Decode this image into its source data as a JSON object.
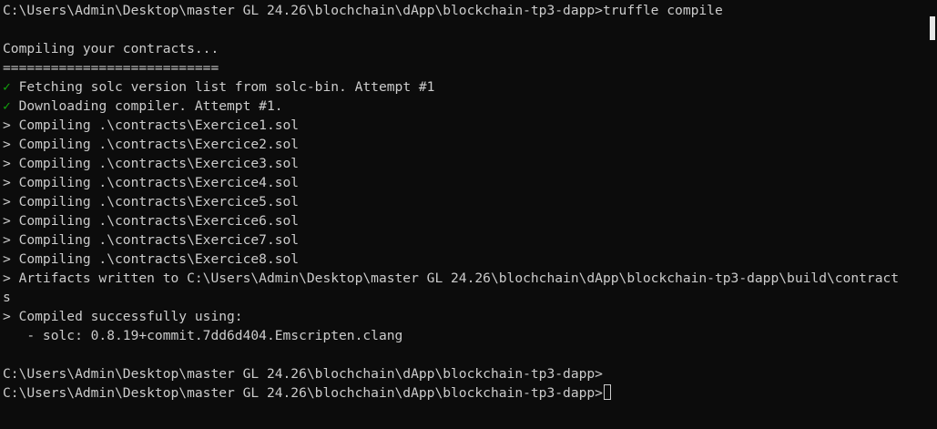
{
  "terminal": {
    "lines": [
      {
        "text": "C:\\Users\\Admin\\Desktop\\master GL 24.26\\blochchain\\dApp\\blockchain-tp3-dapp>truffle compile"
      },
      {
        "text": ""
      },
      {
        "text": "Compiling your contracts..."
      },
      {
        "text": "==========================="
      },
      {
        "mark": "✓",
        "text": " Fetching solc version list from solc-bin. Attempt #1"
      },
      {
        "mark": "✓",
        "text": " Downloading compiler. Attempt #1."
      },
      {
        "text": "> Compiling .\\contracts\\Exercice1.sol"
      },
      {
        "text": "> Compiling .\\contracts\\Exercice2.sol"
      },
      {
        "text": "> Compiling .\\contracts\\Exercice3.sol"
      },
      {
        "text": "> Compiling .\\contracts\\Exercice4.sol"
      },
      {
        "text": "> Compiling .\\contracts\\Exercice5.sol"
      },
      {
        "text": "> Compiling .\\contracts\\Exercice6.sol"
      },
      {
        "text": "> Compiling .\\contracts\\Exercice7.sol"
      },
      {
        "text": "> Compiling .\\contracts\\Exercice8.sol"
      },
      {
        "text": "> Artifacts written to C:\\Users\\Admin\\Desktop\\master GL 24.26\\blochchain\\dApp\\blockchain-tp3-dapp\\build\\contract"
      },
      {
        "text": "s"
      },
      {
        "text": "> Compiled successfully using:"
      },
      {
        "text": "   - solc: 0.8.19+commit.7dd6d404.Emscripten.clang"
      },
      {
        "text": ""
      },
      {
        "text": "C:\\Users\\Admin\\Desktop\\master GL 24.26\\blochchain\\dApp\\blockchain-tp3-dapp>"
      },
      {
        "text": "C:\\Users\\Admin\\Desktop\\master GL 24.26\\blochchain\\dApp\\blockchain-tp3-dapp>"
      }
    ],
    "cursor_line": 20
  },
  "colors": {
    "background": "#0c0c0c",
    "foreground": "#cccccc",
    "checkmark": "#13a10e"
  },
  "icons": {
    "check": "check-icon",
    "cursor": "cursor-icon"
  }
}
